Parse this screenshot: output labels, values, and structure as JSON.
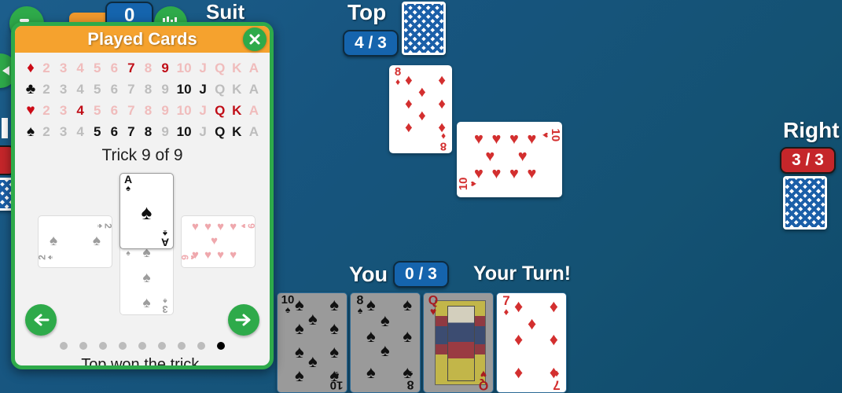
{
  "background": {
    "color": "#15557f"
  },
  "topbar": {
    "bid_badge": "0",
    "suit_label": "Suit",
    "menu_icon": "menu-icon",
    "stats_icon": "stats-icon",
    "orange_button": ""
  },
  "players": {
    "top": {
      "name": "Top",
      "score": "4 / 3",
      "badge_color": "#1564ad"
    },
    "right": {
      "name": "Right",
      "score": "3 / 3",
      "badge_color": "#c5262a"
    },
    "you": {
      "name": "You",
      "score": "0 / 3",
      "badge_color": "#1564ad",
      "turn_text": "Your Turn!"
    }
  },
  "table_cards": [
    {
      "rank": "8",
      "suit": "diamonds",
      "color": "#d32f2f",
      "rotated": false
    },
    {
      "rank": "10",
      "suit": "hearts",
      "color": "#d32f2f",
      "rotated": true
    }
  ],
  "hand": [
    {
      "rank": "10",
      "suit": "spades",
      "color": "#111111",
      "playable": false
    },
    {
      "rank": "8",
      "suit": "spades",
      "color": "#111111",
      "playable": false
    },
    {
      "rank": "Q",
      "suit": "hearts",
      "color": "#c62828",
      "playable": false
    },
    {
      "rank": "7",
      "suit": "diamonds",
      "color": "#d32f2f",
      "playable": true
    }
  ],
  "dialog": {
    "title": "Played Cards",
    "close_icon": "close-icon",
    "ranks": [
      "2",
      "3",
      "4",
      "5",
      "6",
      "7",
      "8",
      "9",
      "10",
      "J",
      "Q",
      "K",
      "A"
    ],
    "suits": [
      {
        "name": "diamonds",
        "symbol": "♦",
        "color": "red",
        "played": [
          "7",
          "9"
        ]
      },
      {
        "name": "clubs",
        "symbol": "♣",
        "color": "black",
        "played": [
          "10",
          "J"
        ]
      },
      {
        "name": "hearts",
        "symbol": "♥",
        "color": "red",
        "played": [
          "4",
          "Q",
          "K"
        ]
      },
      {
        "name": "spades",
        "symbol": "♠",
        "color": "black",
        "played": [
          "5",
          "6",
          "7",
          "8",
          "10",
          "Q",
          "K"
        ]
      }
    ],
    "trick_title": "Trick 9 of 9",
    "trick_status": "Top won the trick.",
    "trick_cards": {
      "top": {
        "rank": "A",
        "suit": "spades",
        "winner": true,
        "rotated": false
      },
      "left": {
        "rank": "2",
        "suit": "spades",
        "winner": false,
        "rotated": true
      },
      "right": {
        "rank": "9",
        "suit": "hearts",
        "winner": false,
        "rotated": true
      },
      "bottom": {
        "rank": "3",
        "suit": "spades",
        "winner": false,
        "rotated": false
      }
    },
    "dots": {
      "total": 9,
      "active_index": 8
    },
    "prev_icon": "arrow-left-icon",
    "next_icon": "arrow-right-icon"
  },
  "left_edge": {
    "arrow_icon": "arrow-left-icon",
    "badge_color": "#c5262a",
    "cardback_icon": "card-back-icon"
  }
}
